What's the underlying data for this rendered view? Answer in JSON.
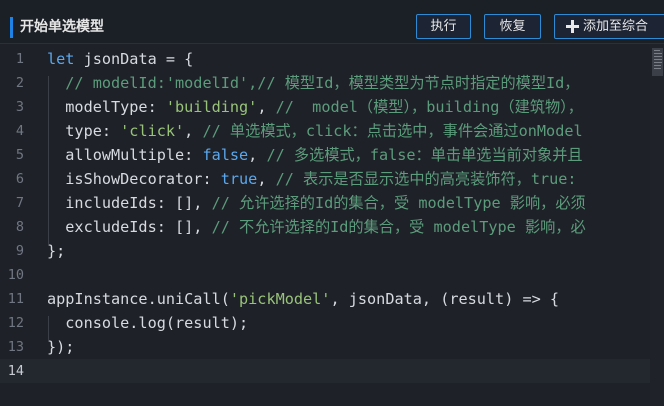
{
  "header": {
    "title": "开始单选模型",
    "buttons": {
      "run": "执行",
      "restore": "恢复",
      "add": "添加至综合"
    }
  },
  "editor": {
    "line_numbers": [
      "1",
      "2",
      "3",
      "4",
      "5",
      "6",
      "7",
      "8",
      "9",
      "10",
      "11",
      "12",
      "13",
      "14"
    ],
    "active_line": "14",
    "lines": [
      [
        {
          "t": "let ",
          "c": "kwb"
        },
        {
          "t": "jsonData = {",
          "c": "pl"
        }
      ],
      [
        {
          "t": "  // modelId:'modelId',// 模型Id，模型类型为节点时指定的模型Id，",
          "c": "cm"
        }
      ],
      [
        {
          "t": "  modelType: ",
          "c": "pl"
        },
        {
          "t": "'building'",
          "c": "str"
        },
        {
          "t": ", ",
          "c": "pl"
        },
        {
          "t": "//  model（模型），building（建筑物），",
          "c": "cm"
        }
      ],
      [
        {
          "t": "  type: ",
          "c": "pl"
        },
        {
          "t": "'click'",
          "c": "str"
        },
        {
          "t": ", ",
          "c": "pl"
        },
        {
          "t": "// 单选模式，click：点击选中，事件会通过onModel",
          "c": "cm"
        }
      ],
      [
        {
          "t": "  allowMultiple: ",
          "c": "pl"
        },
        {
          "t": "false",
          "c": "kwb"
        },
        {
          "t": ", ",
          "c": "pl"
        },
        {
          "t": "// 多选模式，false：单击单选当前对象并且",
          "c": "cm"
        }
      ],
      [
        {
          "t": "  isShowDecorator: ",
          "c": "pl"
        },
        {
          "t": "true",
          "c": "kwb"
        },
        {
          "t": ", ",
          "c": "pl"
        },
        {
          "t": "// 表示是否显示选中的高亮装饰符，true:",
          "c": "cm"
        }
      ],
      [
        {
          "t": "  includeIds: [], ",
          "c": "pl"
        },
        {
          "t": "// 允许选择的Id的集合，受 modelType 影响，必须",
          "c": "cm"
        }
      ],
      [
        {
          "t": "  excludeIds: [], ",
          "c": "pl"
        },
        {
          "t": "// 不允许选择的Id的集合，受 modelType 影响，必",
          "c": "cm"
        }
      ],
      [
        {
          "t": "};",
          "c": "pl"
        }
      ],
      [
        {
          "t": "",
          "c": "pl"
        }
      ],
      [
        {
          "t": "appInstance.uniCall(",
          "c": "pl"
        },
        {
          "t": "'pickModel'",
          "c": "str"
        },
        {
          "t": ", jsonData, (result) => {",
          "c": "pl"
        }
      ],
      [
        {
          "t": "  console.log(result);",
          "c": "pl"
        }
      ],
      [
        {
          "t": "});",
          "c": "pl"
        }
      ],
      [
        {
          "t": "",
          "c": "pl"
        }
      ]
    ]
  },
  "colors": {
    "accent": "#1e82e6",
    "button_border": "#2e8bd6",
    "background": "#1e2127",
    "keyword": "#5aa8ee",
    "string": "#98c379",
    "comment": "#5c9c7c"
  },
  "icons": {
    "add_button": "plus-icon"
  }
}
